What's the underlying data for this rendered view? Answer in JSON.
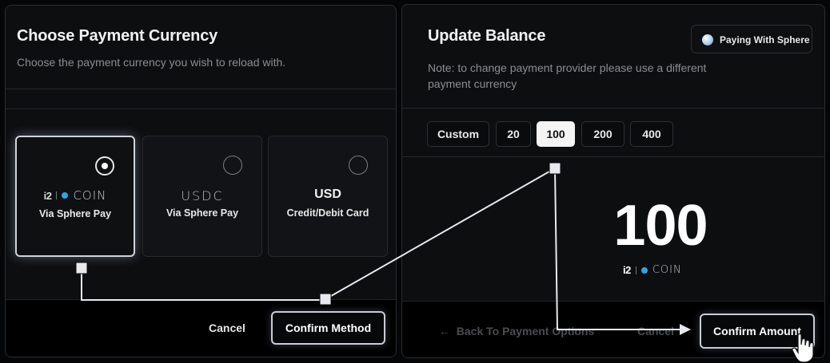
{
  "left": {
    "title": "Choose Payment Currency",
    "subtitle": "Choose the payment currency you wish to reload with.",
    "cards": [
      {
        "logo_brand": "i2",
        "logo_word": "COIN",
        "label": "Via Sphere Pay",
        "selected": true
      },
      {
        "logo": "USDC",
        "label": "Via Sphere Pay",
        "selected": false
      },
      {
        "logo": "USD",
        "label": "Credit/Debit Card",
        "selected": false
      }
    ],
    "cancel_label": "Cancel",
    "confirm_label": "Confirm Method"
  },
  "right": {
    "title": "Update Balance",
    "paying_badge": "Paying With Sphere",
    "note": "Note: to change payment provider please use a different payment currency",
    "amount_options": [
      "Custom",
      "20",
      "100",
      "200",
      "400"
    ],
    "selected_amount": "100",
    "big_amount": "100",
    "currency_brand": "i2",
    "currency_word": "COIN",
    "back_label": "Back To Payment Options",
    "cancel_label": "Cancel",
    "confirm_label": "Confirm Amount",
    "back_arrow": "←"
  },
  "colors": {
    "accent_dot": "#2aa7e6",
    "panel_bg": "#0d0e10",
    "footer_bg": "#000000",
    "active_chip": "#f4f4f5"
  },
  "icons": [
    "radio-selected-icon",
    "radio-unselected-icon",
    "sphere-logo-icon",
    "coin-dot-icon",
    "back-arrow-icon",
    "hand-cursor-icon"
  ]
}
